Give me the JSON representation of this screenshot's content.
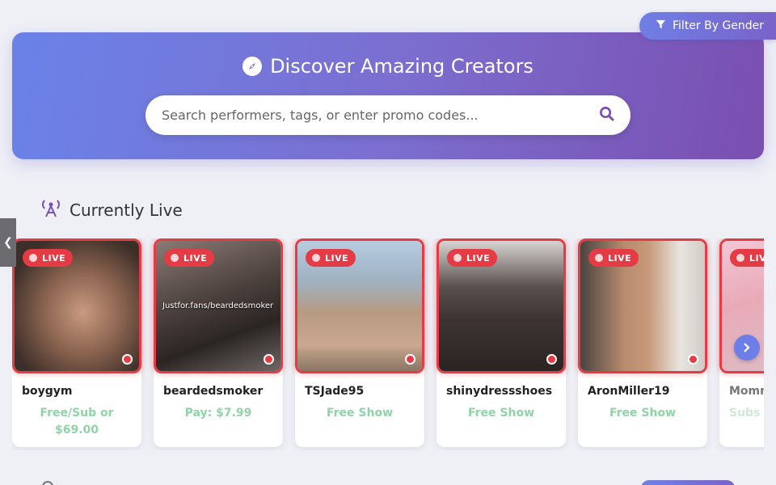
{
  "filter": {
    "label": "Filter By Gender",
    "icon": "filter-icon"
  },
  "hero": {
    "title": "Discover Amazing Creators",
    "icon": "compass-icon",
    "search_placeholder": "Search performers, tags, or enter promo codes..."
  },
  "live_section": {
    "title": "Currently Live",
    "icon": "broadcast-icon",
    "cards": [
      {
        "name": "boygym",
        "price": "Free/Sub or $69.00",
        "badge": "LIVE",
        "overlay": ""
      },
      {
        "name": "beardedsmoker",
        "price": "Pay: $7.99",
        "badge": "LIVE",
        "overlay": "Justfor.fans/beardedsmoker"
      },
      {
        "name": "TSJade95",
        "price": "Free Show",
        "badge": "LIVE",
        "overlay": ""
      },
      {
        "name": "shinydressshoes",
        "price": "Free Show",
        "badge": "LIVE",
        "overlay": ""
      },
      {
        "name": "AronMiller19",
        "price": "Free Show",
        "badge": "LIVE",
        "overlay": ""
      },
      {
        "name": "Momm",
        "price": "Subs",
        "badge": "LIVE",
        "overlay": ""
      }
    ]
  },
  "colors": {
    "accent": "#6d7fe6",
    "live_red": "#e53b45",
    "price_green": "#8fd3a6"
  }
}
